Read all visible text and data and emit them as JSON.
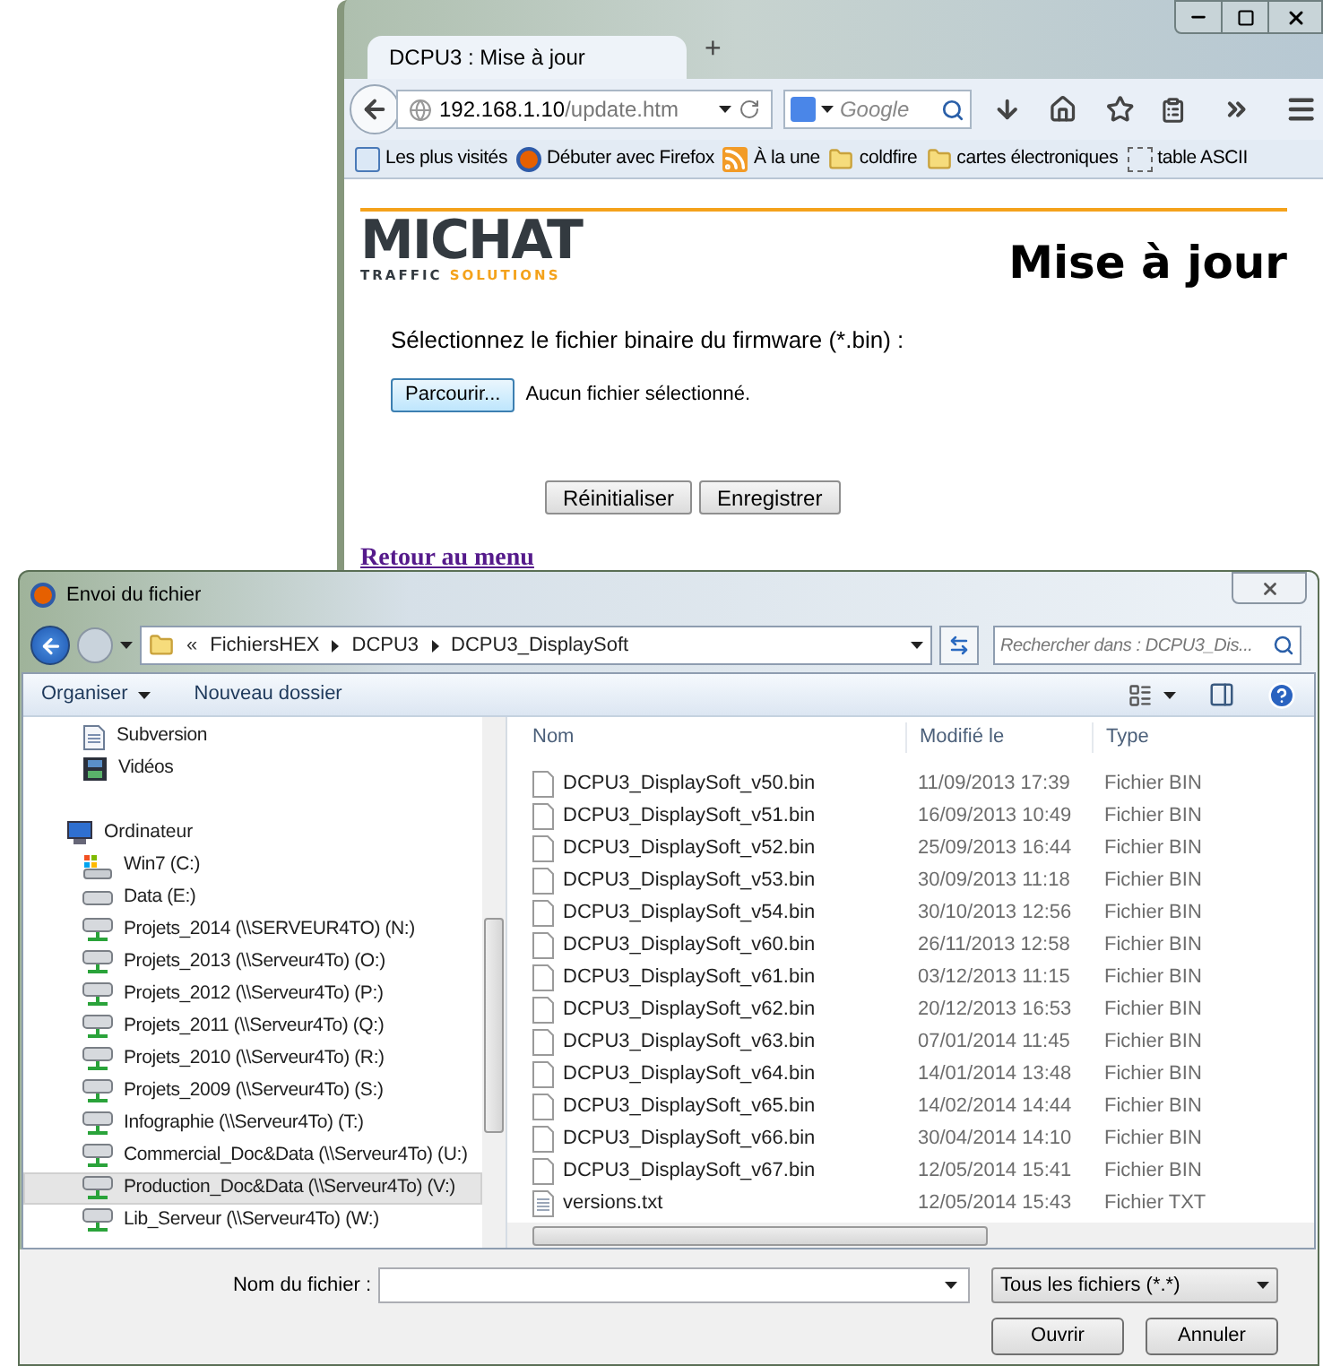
{
  "browser": {
    "tab_title": "DCPU3 : Mise à jour",
    "new_tab": "+",
    "url_host": "192.168.1.10",
    "url_path": "/update.htm",
    "search_placeholder": "Google",
    "bookmarks": [
      {
        "label": "Les plus visités",
        "kind": "smart"
      },
      {
        "label": "Débuter avec Firefox",
        "kind": "firefox"
      },
      {
        "label": "À la une",
        "kind": "feed"
      },
      {
        "label": "coldfire",
        "kind": "folder"
      },
      {
        "label": "cartes électroniques",
        "kind": "folder"
      },
      {
        "label": "table ASCII",
        "kind": "blank"
      }
    ],
    "page": {
      "logo": {
        "name": "MICHAT",
        "tagline": "TRAFFIC",
        "tagline_accent": "SOLUTIONS"
      },
      "heading": "Mise à jour",
      "prompt": "Sélectionnez le fichier binaire du firmware (*.bin) :",
      "browse_button": "Parcourir...",
      "no_file": "Aucun fichier sélectionné.",
      "buttons": [
        "Réinitialiser",
        "Enregistrer"
      ],
      "back_link": "Retour au menu"
    }
  },
  "dialog": {
    "title": "Envoi du fichier",
    "breadcrumb": {
      "overflow": "«",
      "items": [
        "FichiersHEX",
        "DCPU3",
        "DCPU3_DisplaySoft"
      ]
    },
    "search_placeholder": "Rechercher dans : DCPU3_Dis...",
    "toolbar": {
      "organize": "Organiser",
      "new_folder": "Nouveau dossier"
    },
    "nav": {
      "libraries_children": [
        {
          "label": "Subversion",
          "kind": "document",
          "selected": false
        },
        {
          "label": "Vidéos",
          "kind": "video",
          "selected": false
        }
      ],
      "computer": {
        "label": "Ordinateur",
        "selected": false,
        "children": [
          {
            "label": "Win7 (C:)",
            "kind": "system-drive",
            "selected": false
          },
          {
            "label": "Data (E:)",
            "kind": "drive",
            "selected": false
          },
          {
            "label": "Projets_2014 (\\\\SERVEUR4TO) (N:)",
            "kind": "network-drive",
            "selected": false
          },
          {
            "label": "Projets_2013 (\\\\Serveur4To) (O:)",
            "kind": "network-drive",
            "selected": false
          },
          {
            "label": "Projets_2012 (\\\\Serveur4To) (P:)",
            "kind": "network-drive",
            "selected": false
          },
          {
            "label": "Projets_2011 (\\\\Serveur4To) (Q:)",
            "kind": "network-drive",
            "selected": false
          },
          {
            "label": "Projets_2010 (\\\\Serveur4To) (R:)",
            "kind": "network-drive",
            "selected": false
          },
          {
            "label": "Projets_2009 (\\\\Serveur4To) (S:)",
            "kind": "network-drive",
            "selected": false
          },
          {
            "label": "Infographie (\\\\Serveur4To) (T:)",
            "kind": "network-drive",
            "selected": false
          },
          {
            "label": "Commercial_Doc&Data (\\\\Serveur4To) (U:)",
            "kind": "network-drive",
            "selected": false
          },
          {
            "label": "Production_Doc&Data (\\\\Serveur4To) (V:)",
            "kind": "network-drive",
            "selected": true
          },
          {
            "label": "Lib_Serveur (\\\\Serveur4To) (W:)",
            "kind": "network-drive",
            "selected": false
          }
        ]
      }
    },
    "columns": [
      "Nom",
      "Modifié le",
      "Type"
    ],
    "files": [
      {
        "name": "DCPU3_DisplaySoft_v50.bin",
        "modified": "11/09/2013 17:39",
        "type": "Fichier BIN",
        "kind": "bin",
        "selected": false
      },
      {
        "name": "DCPU3_DisplaySoft_v51.bin",
        "modified": "16/09/2013 10:49",
        "type": "Fichier BIN",
        "kind": "bin",
        "selected": false
      },
      {
        "name": "DCPU3_DisplaySoft_v52.bin",
        "modified": "25/09/2013 16:44",
        "type": "Fichier BIN",
        "kind": "bin",
        "selected": false
      },
      {
        "name": "DCPU3_DisplaySoft_v53.bin",
        "modified": "30/09/2013 11:18",
        "type": "Fichier BIN",
        "kind": "bin",
        "selected": false
      },
      {
        "name": "DCPU3_DisplaySoft_v54.bin",
        "modified": "30/10/2013 12:56",
        "type": "Fichier BIN",
        "kind": "bin",
        "selected": false
      },
      {
        "name": "DCPU3_DisplaySoft_v60.bin",
        "modified": "26/11/2013 12:58",
        "type": "Fichier BIN",
        "kind": "bin",
        "selected": false
      },
      {
        "name": "DCPU3_DisplaySoft_v61.bin",
        "modified": "03/12/2013 11:15",
        "type": "Fichier BIN",
        "kind": "bin",
        "selected": false
      },
      {
        "name": "DCPU3_DisplaySoft_v62.bin",
        "modified": "20/12/2013 16:53",
        "type": "Fichier BIN",
        "kind": "bin",
        "selected": false
      },
      {
        "name": "DCPU3_DisplaySoft_v63.bin",
        "modified": "07/01/2014 11:45",
        "type": "Fichier BIN",
        "kind": "bin",
        "selected": false
      },
      {
        "name": "DCPU3_DisplaySoft_v64.bin",
        "modified": "14/01/2014 13:48",
        "type": "Fichier BIN",
        "kind": "bin",
        "selected": false
      },
      {
        "name": "DCPU3_DisplaySoft_v65.bin",
        "modified": "14/02/2014 14:44",
        "type": "Fichier BIN",
        "kind": "bin",
        "selected": false
      },
      {
        "name": "DCPU3_DisplaySoft_v66.bin",
        "modified": "30/04/2014 14:10",
        "type": "Fichier BIN",
        "kind": "bin",
        "selected": false
      },
      {
        "name": "DCPU3_DisplaySoft_v67.bin",
        "modified": "12/05/2014 15:41",
        "type": "Fichier BIN",
        "kind": "bin",
        "selected": false
      },
      {
        "name": "versions.txt",
        "modified": "12/05/2014 15:43",
        "type": "Fichier TXT",
        "kind": "text",
        "selected": false
      }
    ],
    "filename_label": "Nom du fichier :",
    "filter": "Tous les fichiers (*.*)",
    "buttons": [
      "Ouvrir",
      "Annuler"
    ]
  }
}
